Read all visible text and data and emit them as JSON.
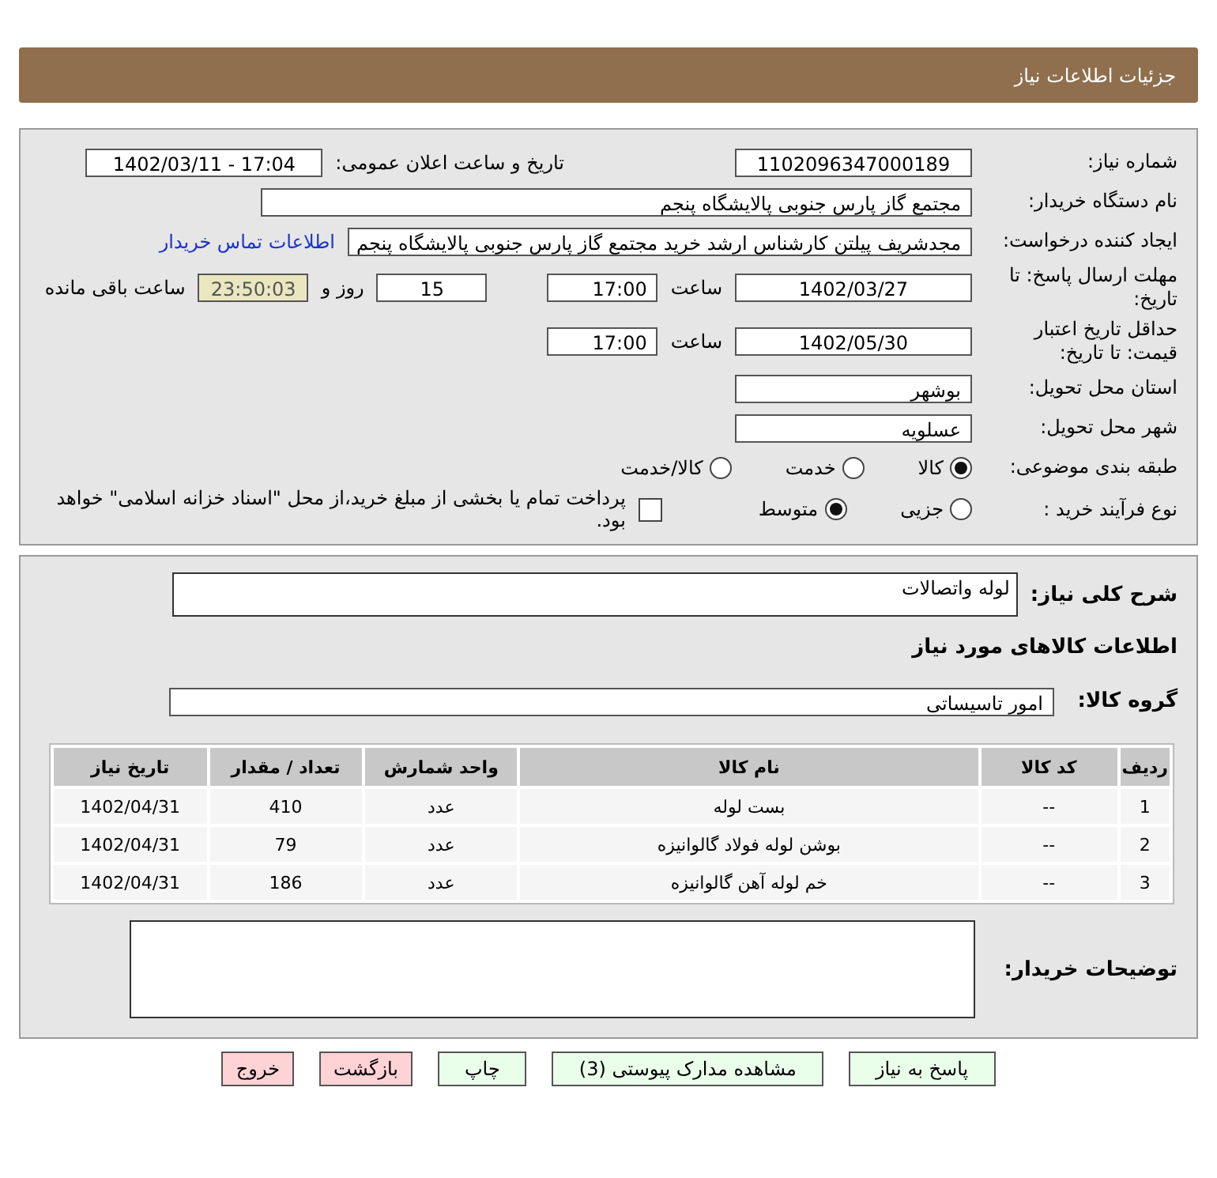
{
  "header": {
    "title": "جزئیات اطلاعات نیاز"
  },
  "details": {
    "need_number": {
      "label": "شماره نیاز:",
      "value": "1102096347000189"
    },
    "announce": {
      "label": "تاریخ و ساعت اعلان عمومی:",
      "value": "1402/03/11 - 17:04"
    },
    "buyer_org": {
      "label": "نام دستگاه خریدار:",
      "value": "مجتمع گاز پارس جنوبی  پالایشگاه پنجم"
    },
    "requester": {
      "label": "ایجاد کننده درخواست:",
      "value": "مجدشریف پیلتن کارشناس ارشد خرید مجتمع گاز پارس جنوبی  پالایشگاه پنجم",
      "link": "اطلاعات تماس خریدار"
    },
    "deadline": {
      "label": "مهلت ارسال پاسخ: تا تاریخ:",
      "date": "1402/03/27",
      "time_label": "ساعت",
      "time": "17:00",
      "days": "15",
      "days_label": "روز و",
      "remaining": "23:50:03",
      "remaining_label": "ساعت باقی مانده"
    },
    "validity": {
      "label": "حداقل تاریخ اعتبار قیمت: تا تاریخ:",
      "date": "1402/05/30",
      "time_label": "ساعت",
      "time": "17:00"
    },
    "province": {
      "label": "استان محل تحویل:",
      "value": "بوشهر"
    },
    "city": {
      "label": "شهر محل تحویل:",
      "value": "عسلویه"
    },
    "category": {
      "label": "طبقه بندی موضوعی:",
      "options": [
        {
          "label": "کالا",
          "selected": true
        },
        {
          "label": "خدمت",
          "selected": false
        },
        {
          "label": "کالا/خدمت",
          "selected": false
        }
      ]
    },
    "process": {
      "label": "نوع فرآیند خرید :",
      "options": [
        {
          "label": "جزیی",
          "selected": false
        },
        {
          "label": "متوسط",
          "selected": true
        }
      ],
      "payment": {
        "label": "پرداخت تمام یا بخشی از مبلغ خرید،از محل \"اسناد خزانه اسلامی\" خواهد بود.",
        "checked": false
      }
    }
  },
  "goods": {
    "summary": {
      "label": "شرح کلی نیاز:",
      "value": "لوله واتصالات"
    },
    "heading": "اطلاعات کالاهای مورد نیاز",
    "group": {
      "label": "گروه کالا:",
      "value": "امور تاسیساتی"
    },
    "table": {
      "columns": [
        "ردیف",
        "کد کالا",
        "نام کالا",
        "واحد شمارش",
        "تعداد / مقدار",
        "تاریخ نیاز"
      ],
      "rows": [
        [
          "1",
          "--",
          "بست لوله",
          "عدد",
          "410",
          "1402/04/31"
        ],
        [
          "2",
          "--",
          "بوشن لوله فولاد گالوانیزه",
          "عدد",
          "79",
          "1402/04/31"
        ],
        [
          "3",
          "--",
          "خم لوله آهن گالوانیزه",
          "عدد",
          "186",
          "1402/04/31"
        ]
      ]
    },
    "buyer_notes": {
      "label": "توضیحات خریدار:"
    }
  },
  "buttons": [
    {
      "label": "پاسخ به نیاز",
      "kind": "normal"
    },
    {
      "label": "مشاهده مدارک پیوستی (3)",
      "kind": "normal"
    },
    {
      "label": "چاپ",
      "kind": "normal"
    },
    {
      "label": "بازگشت",
      "kind": "danger"
    },
    {
      "label": "خروج",
      "kind": "danger"
    }
  ]
}
